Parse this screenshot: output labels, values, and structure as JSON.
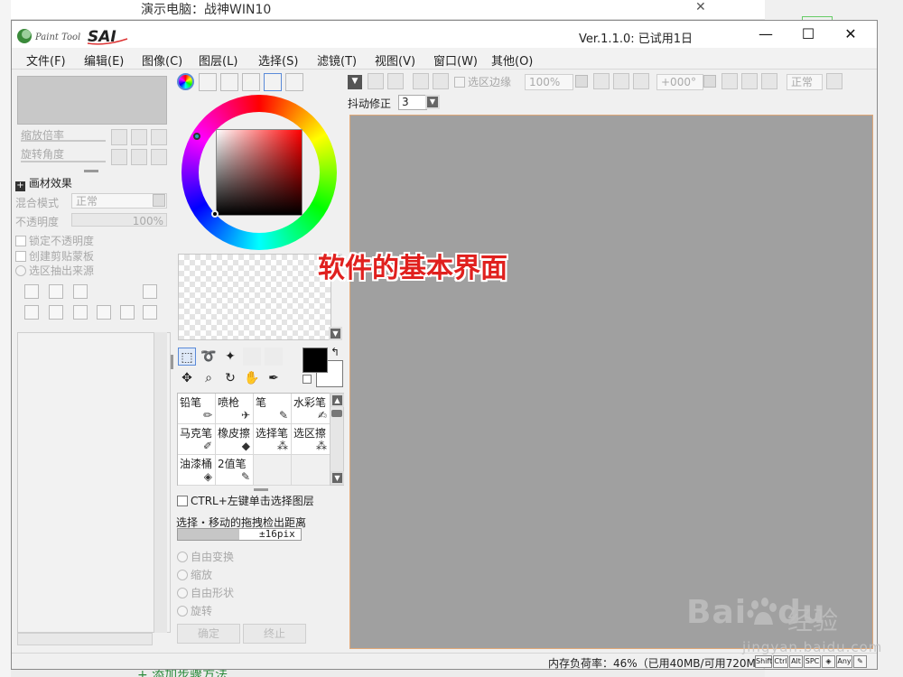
{
  "background_page": {
    "top_text": "演示电脑：战神WIN10",
    "close_glyph": "✕",
    "bottom_link": "+ 添加步骤方法"
  },
  "window": {
    "app_logo_text": "PaintTool SAI",
    "title": "Ver.1.1.0: 已试用1日",
    "controls": {
      "minimize": "—",
      "maximize": "☐",
      "close": "✕"
    }
  },
  "menu": [
    "文件(F)",
    "编辑(E)",
    "图像(C)",
    "图层(L)",
    "选择(S)",
    "滤镜(T)",
    "视图(V)",
    "窗口(W)",
    "其他(O)"
  ],
  "navigator": {
    "zoom_label": "缩放倍率",
    "rotate_label": "旋转角度"
  },
  "layer_props": {
    "effect_header": "画材效果",
    "blend_label": "混合模式",
    "blend_value": "正常",
    "opacity_label": "不透明度",
    "opacity_value": "100%",
    "lock_opacity": "锁定不透明度",
    "create_clip": "创建剪贴蒙板",
    "select_source": "选区抽出来源"
  },
  "tools": {
    "brushes": [
      {
        "label": "铅笔",
        "icon": "pencil-icon"
      },
      {
        "label": "喷枪",
        "icon": "airbrush-icon"
      },
      {
        "label": "笔",
        "icon": "pen-icon"
      },
      {
        "label": "水彩笔",
        "icon": "watercolor-icon"
      },
      {
        "label": "马克笔",
        "icon": "marker-icon"
      },
      {
        "label": "橡皮擦",
        "icon": "eraser-icon"
      },
      {
        "label": "选择笔",
        "icon": "select-pen-icon"
      },
      {
        "label": "选区擦",
        "icon": "select-eraser-icon"
      },
      {
        "label": "油漆桶",
        "icon": "bucket-icon"
      },
      {
        "label": "2值笔",
        "icon": "binary-pen-icon"
      }
    ],
    "ctrl_click_label": "CTRL+左键单击选择图层",
    "drag_distance_label": "选择・移动的拖拽检出距离",
    "drag_distance_value": "±16pix",
    "drag_distance_fraction": 0.5,
    "transform_options": [
      "自由变换",
      "缩放",
      "自由形状",
      "旋转"
    ],
    "ok_label": "确定",
    "cancel_label": "终止"
  },
  "canvas_toolbar": {
    "selection_edge": "选区边缘",
    "zoom": "100%",
    "angle": "+000°",
    "blend": "正常",
    "stabilizer_label": "抖动修正",
    "stabilizer_value": "3"
  },
  "canvas": {
    "annotation": "软件的基本界面",
    "color": "#a0a0a0"
  },
  "status": {
    "memory": "内存负荷率：46%（已用40MB/可用720MB）",
    "keys": [
      "Shift",
      "Ctrl",
      "Alt",
      "SPC",
      "◈",
      "Any",
      "✎"
    ]
  },
  "watermark": {
    "brand": "Bai",
    "brand2": "du",
    "sub": "经验",
    "url": "jingyan.baidu.com"
  }
}
